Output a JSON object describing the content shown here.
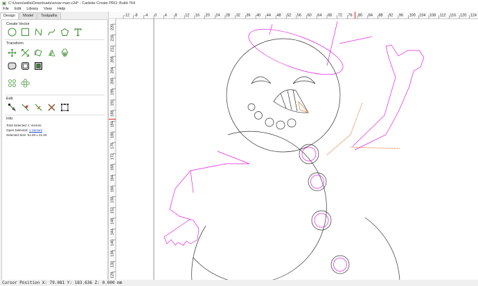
{
  "window": {
    "title": "C:\\Users\\willa\\Downloads\\snow man.c2d* - Carbide Create PRO: Build 764"
  },
  "menubar": [
    "File",
    "Edit",
    "Library",
    "View",
    "Help"
  ],
  "tabs": [
    {
      "label": "Design",
      "active": true
    },
    {
      "label": "Model",
      "active": false
    },
    {
      "label": "Toolpaths",
      "active": false
    }
  ],
  "sections": {
    "create_vector": "Create Vector",
    "transform": "Transform",
    "edit": "Edit",
    "info": "Info"
  },
  "info": {
    "total_selected_label": "Total Selected:",
    "total_selected_value": "1 Vectors",
    "open_selected_label": "Open Selected:",
    "open_selected_value": "1 Vectors",
    "selected_size_label": "Selected Size:",
    "selected_size_value": "51.00 x 21.00"
  },
  "ruler": {
    "x_ticks": [
      "-12",
      "-8",
      "-4",
      "0",
      "4",
      "8",
      "12",
      "16",
      "20",
      "24",
      "28",
      "32",
      "36",
      "40",
      "44",
      "48",
      "52",
      "56",
      "60",
      "64",
      "68",
      "72",
      "76",
      "80",
      "84",
      "88",
      "92",
      "96",
      "100",
      "104",
      "108",
      "112",
      "116",
      "120",
      "124",
      "128"
    ],
    "y_ticks": [
      "220",
      "216",
      "212",
      "208",
      "204",
      "200",
      "196",
      "192",
      "188",
      "184",
      "180",
      "176",
      "172",
      "168",
      "164",
      "160",
      "156",
      "152",
      "148",
      "144",
      "140",
      "136",
      "132",
      "128"
    ]
  },
  "status": {
    "cursor_position": "Cursor Position X: 79.081 Y: 183.636 Z: 0.000 mm"
  },
  "colors": {
    "accent_green": "#3a8f2f",
    "vector_magenta": "#e020e0",
    "selected_orange": "#e07a30",
    "ruler_marker_red": "#e02020"
  }
}
